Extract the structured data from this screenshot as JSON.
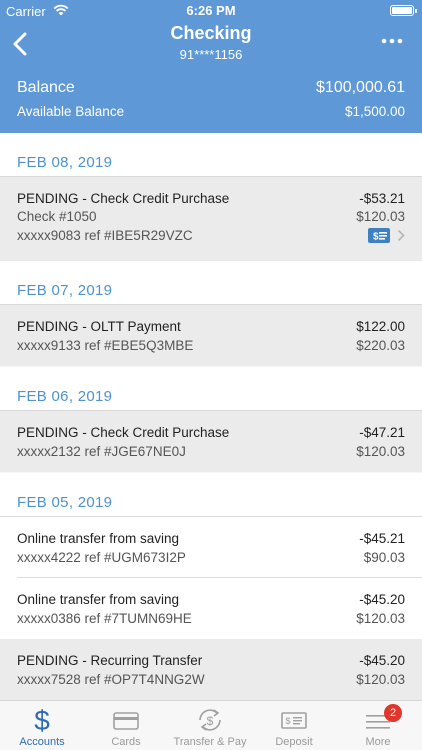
{
  "status_bar": {
    "carrier": "Carrier",
    "time": "6:26 PM"
  },
  "header": {
    "title": "Checking",
    "account_number": "91****1156"
  },
  "balance": {
    "balance_label": "Balance",
    "balance_value": "$100,000.61",
    "available_label": "Available Balance",
    "available_value": "$1,500.00"
  },
  "groups": [
    {
      "date": "FEB 08, 2019",
      "transactions": [
        {
          "description": "PENDING - Check Credit Purchase",
          "detail1": "Check #1050",
          "detail2": "xxxxx9083 ref #IBE5R29VZC",
          "amount": "-$53.21",
          "balance": "$120.03"
        }
      ]
    },
    {
      "date": "FEB 07, 2019",
      "transactions": [
        {
          "description": "PENDING - OLTT Payment",
          "detail1": "xxxxx9133 ref #EBE5Q3MBE",
          "amount": "$122.00",
          "balance": "$220.03"
        }
      ]
    },
    {
      "date": "FEB 06, 2019",
      "transactions": [
        {
          "description": "PENDING - Check Credit Purchase",
          "detail1": "xxxxx2132 ref #JGE67NE0J",
          "amount": "-$47.21",
          "balance": "$120.03"
        }
      ]
    },
    {
      "date": "FEB 05, 2019",
      "transactions": [
        {
          "description": "Online transfer from saving",
          "detail1": "xxxxx4222 ref #UGM673I2P",
          "amount": "-$45.21",
          "balance": "$90.03"
        },
        {
          "description": "Online transfer from saving",
          "detail1": "xxxxx0386 ref #7TUMN69HE",
          "amount": "-$45.20",
          "balance": "$120.03"
        },
        {
          "description": "PENDING - Recurring Transfer",
          "detail1": "xxxxx7528 ref #OP7T4NNG2W",
          "amount": "-$45.20",
          "balance": "$120.03"
        }
      ]
    }
  ],
  "tabbar": {
    "tabs": [
      {
        "label": "Accounts",
        "icon": "dollar-icon"
      },
      {
        "label": "Cards",
        "icon": "card-icon"
      },
      {
        "label": "Transfer & Pay",
        "icon": "transfer-icon"
      },
      {
        "label": "Deposit",
        "icon": "check-deposit-icon"
      },
      {
        "label": "More",
        "icon": "menu-icon",
        "badge": "2"
      }
    ]
  },
  "colors": {
    "header_bg": "#5e98d6",
    "date_text": "#4f92cf",
    "active_tab": "#2f6db0",
    "badge": "#e0362c"
  }
}
